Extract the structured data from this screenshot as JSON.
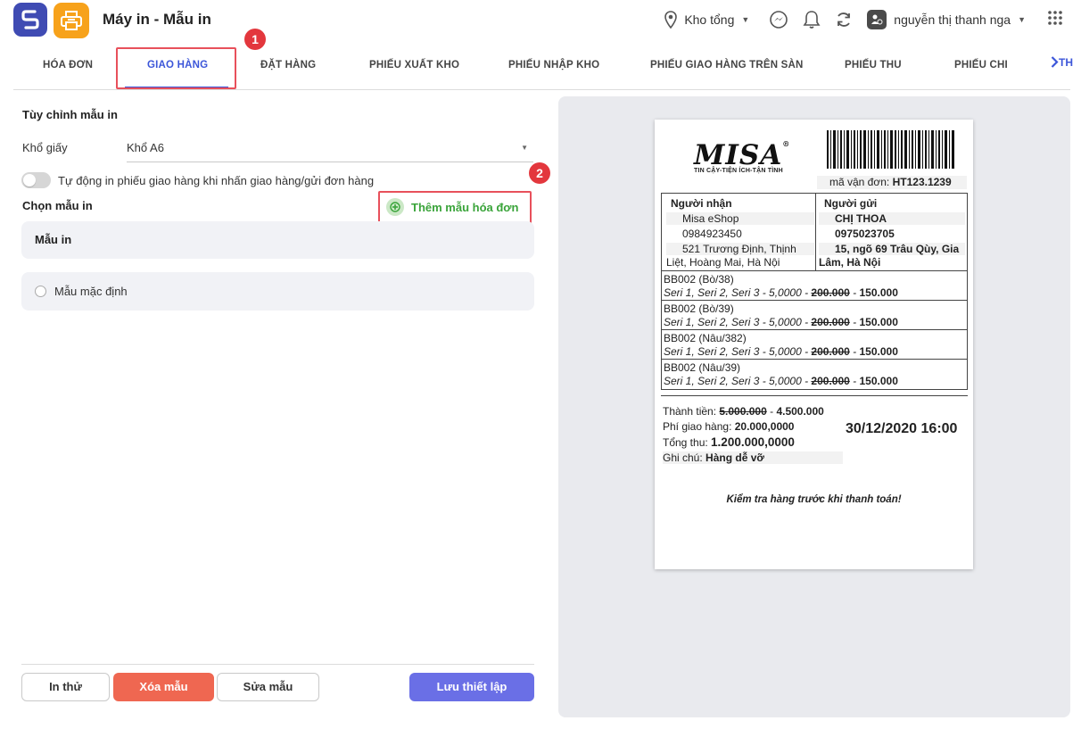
{
  "header": {
    "title": "Máy in - Mẫu in",
    "warehouse": "Kho tổng",
    "user_name": "nguyễn thị thanh nga"
  },
  "tabs": [
    {
      "label": "HÓA ĐƠN"
    },
    {
      "label": "GIAO HÀNG"
    },
    {
      "label": "ĐẶT HÀNG"
    },
    {
      "label": "PHIẾU XUẤT KHO"
    },
    {
      "label": "PHIẾU NHẬP KHO"
    },
    {
      "label": "PHIẾU GIAO HÀNG TRÊN SÀN"
    },
    {
      "label": "PHIẾU THU"
    },
    {
      "label": "PHIẾU CHI"
    }
  ],
  "more_tab": "TH",
  "steps": {
    "one": "1",
    "two": "2"
  },
  "settings": {
    "section_title": "Tùy chỉnh mẫu in",
    "paper_label": "Khổ giấy",
    "paper_value": "Khổ A6",
    "auto_print_label": "Tự động in phiếu giao hàng khi nhấn giao hàng/gửi đơn hàng"
  },
  "templates": {
    "section_title": "Chọn mẫu in",
    "add_label": "Thêm mẫu hóa đơn",
    "group_label": "Mẫu in",
    "default_label": "Mẫu mặc định"
  },
  "buttons": {
    "test": "In thử",
    "delete": "Xóa mẫu",
    "edit": "Sửa mẫu",
    "save": "Lưu thiết lập"
  },
  "receipt": {
    "logo": "MISA",
    "tagline": "TIN CẬY-TIỆN ÍCH-TẬN TÌNH",
    "waybill_label": "mã vận đơn:",
    "waybill_value": "HT123.1239",
    "receiver": {
      "title": "Người nhận",
      "name": "Misa eShop",
      "phone": "0984923450",
      "addr1": "521 Trương Định, Thịnh",
      "addr2": "Liệt, Hoàng Mai, Hà Nội"
    },
    "sender": {
      "title": "Người gửi",
      "name": "CHỊ THOA",
      "phone": "0975023705",
      "addr1": "15, ngõ 69 Trâu Qùy, Gia",
      "addr2": "Lâm, Hà Nội"
    },
    "items": [
      {
        "name": "BB002 (Bò/38)",
        "detail": "Seri 1, Seri 2, Seri 3 - 5,0000 - ",
        "old_price": "200.000",
        "sep": " - ",
        "price": "150.000"
      },
      {
        "name": "BB002 (Bò/39)",
        "detail": "Seri 1, Seri 2, Seri 3 - 5,0000 - ",
        "old_price": "200.000",
        "sep": " - ",
        "price": "150.000"
      },
      {
        "name": "BB002 (Nâu/382)",
        "detail": "Seri 1, Seri 2, Seri 3 - 5,0000 - ",
        "old_price": "200.000",
        "sep": " - ",
        "price": "150.000"
      },
      {
        "name": "BB002 (Nâu/39)",
        "detail": "Seri 1, Seri 2, Seri 3 - 5,0000 - ",
        "old_price": "200.000",
        "sep": " - ",
        "price": "150.000"
      }
    ],
    "subtotal_label": "Thành tiền: ",
    "subtotal_old": "5.000.000",
    "subtotal_sep": " - ",
    "subtotal_value": "4.500.000",
    "shipping_label": "Phí giao hàng: ",
    "shipping_value": "20.000,0000",
    "total_label": "Tổng thu: ",
    "total_value": "1.200.000,0000",
    "note_label": "Ghi chú: ",
    "note_value": "Hàng dễ vỡ",
    "datetime": "30/12/2020 16:00",
    "footer": "Kiểm tra hàng trước khi thanh toán!"
  },
  "colors": {
    "accent": "#3c56d9",
    "danger": "#ef6751",
    "primary": "#6a6fe6",
    "highlight": "#e8505b",
    "success": "#3aa43a"
  }
}
